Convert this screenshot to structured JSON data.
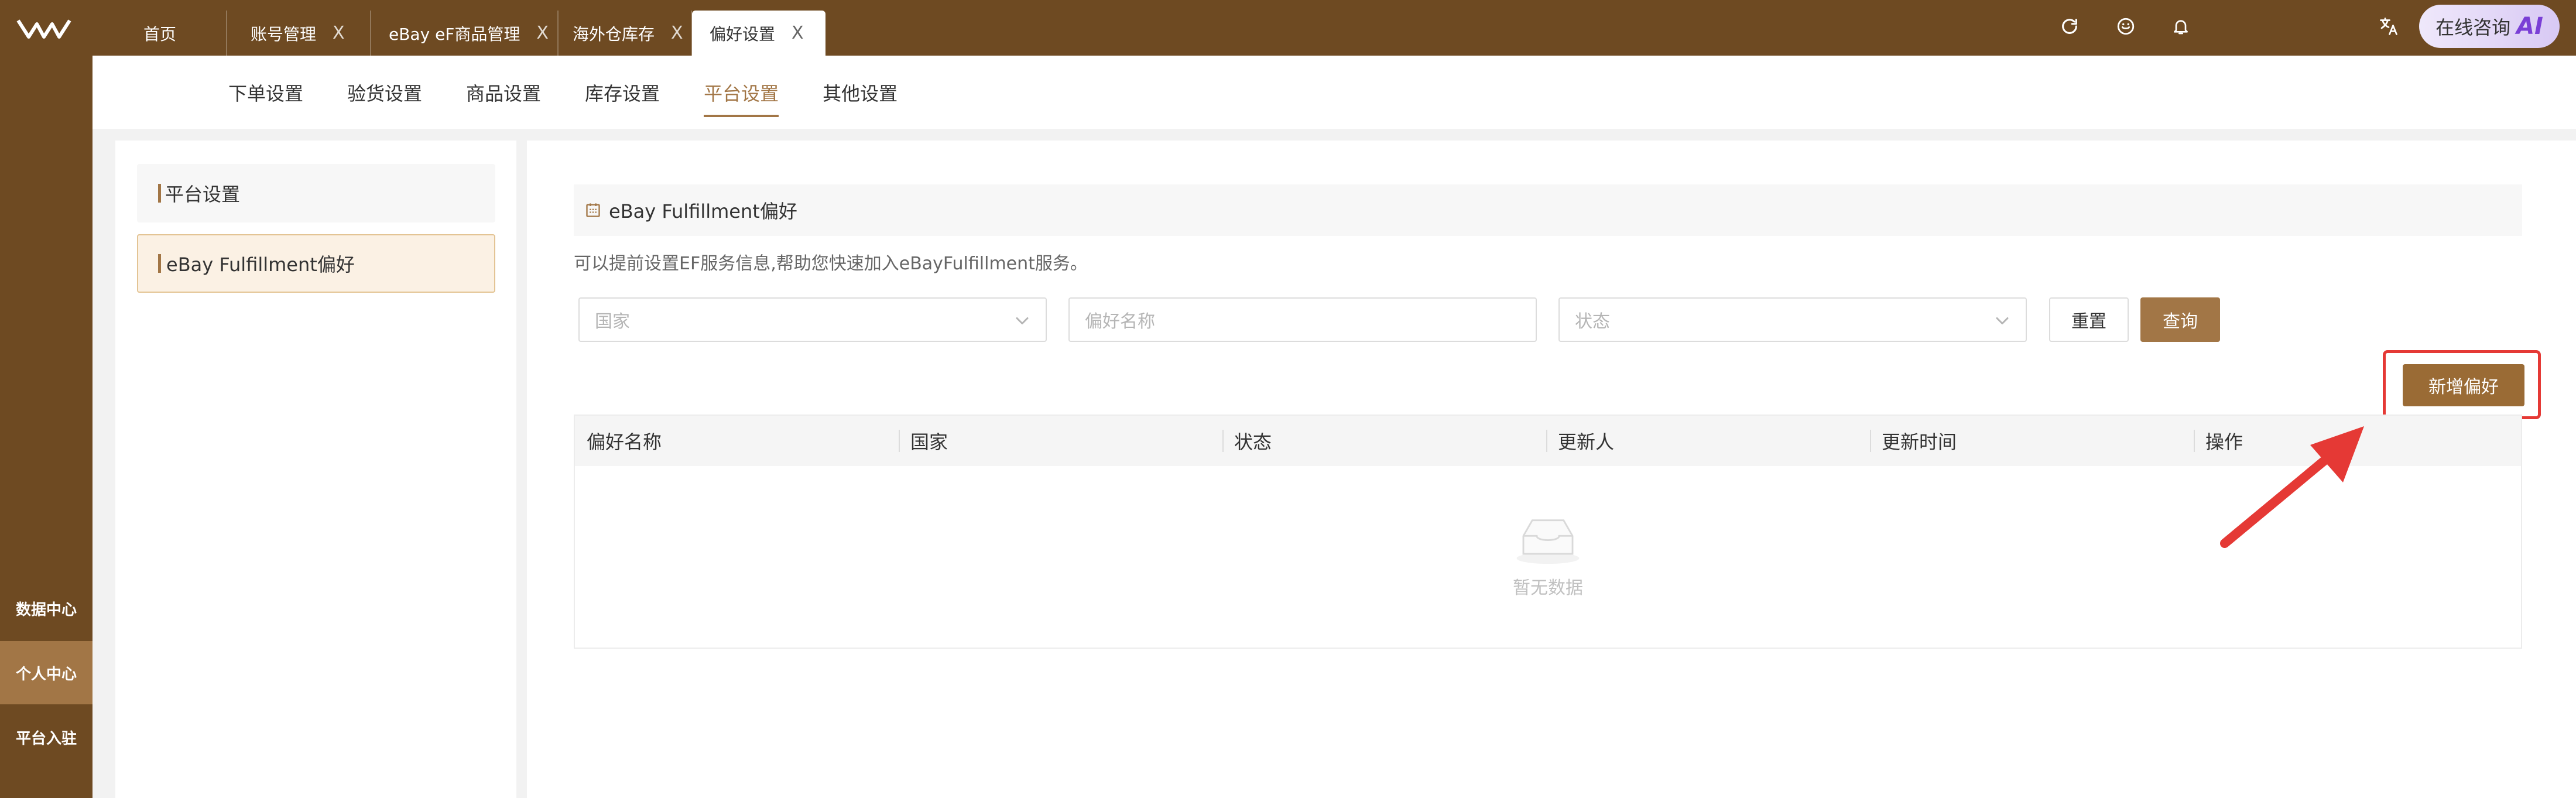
{
  "topbar": {
    "tabs": [
      {
        "label": "首页",
        "closable": false,
        "active": false
      },
      {
        "label": "账号管理",
        "closable": true,
        "active": false
      },
      {
        "label": "eBay eF商品管理",
        "closable": true,
        "active": false
      },
      {
        "label": "海外仓库存",
        "closable": true,
        "active": false
      },
      {
        "label": "偏好设置",
        "closable": true,
        "active": true
      }
    ],
    "close_glyph": "X",
    "icons": [
      "refresh-icon",
      "smile-icon",
      "bell-icon",
      "translate-icon"
    ],
    "consult_label": "在线咨询",
    "consult_badge": "AI"
  },
  "sidebar": {
    "items": [
      {
        "label": "数据中心",
        "active": false
      },
      {
        "label": "个人中心",
        "active": true
      },
      {
        "label": "平台入驻",
        "active": false
      }
    ]
  },
  "subnav": {
    "tabs": [
      {
        "label": "下单设置",
        "active": false
      },
      {
        "label": "验货设置",
        "active": false
      },
      {
        "label": "商品设置",
        "active": false
      },
      {
        "label": "库存设置",
        "active": false
      },
      {
        "label": "平台设置",
        "active": true
      },
      {
        "label": "其他设置",
        "active": false
      }
    ]
  },
  "leftpanel": {
    "header": "平台设置",
    "selected_item": "eBay Fulfillment偏好"
  },
  "main": {
    "section_title": "eBay Fulfillment偏好",
    "hint": "可以提前设置EF服务信息,帮助您快速加入eBayFulfillment服务。",
    "filters": {
      "country_placeholder": "国家",
      "name_placeholder": "偏好名称",
      "status_placeholder": "状态"
    },
    "reset_label": "重置",
    "query_label": "查询",
    "add_label": "新增偏好",
    "table": {
      "columns": [
        "偏好名称",
        "国家",
        "状态",
        "更新人",
        "更新时间",
        "操作"
      ],
      "rows": [],
      "empty_text": "暂无数据"
    }
  },
  "colors": {
    "brand": "#6e4a22",
    "accent": "#a27646",
    "highlight": "#e53935"
  }
}
